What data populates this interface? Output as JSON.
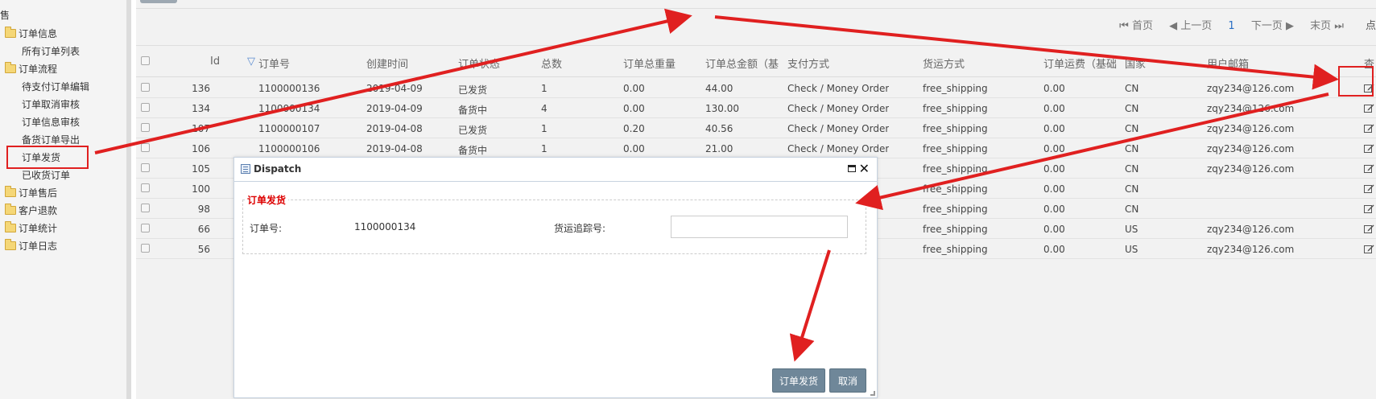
{
  "sidebar": {
    "top_label": "售",
    "items": [
      {
        "type": "folder",
        "label": "订单信息"
      },
      {
        "type": "leaf",
        "label": "所有订单列表"
      },
      {
        "type": "folder",
        "label": "订单流程"
      },
      {
        "type": "leaf",
        "label": "待支付订单编辑"
      },
      {
        "type": "leaf",
        "label": "订单取消审核"
      },
      {
        "type": "leaf",
        "label": "订单信息审核"
      },
      {
        "type": "leaf",
        "label": "备货订单导出"
      },
      {
        "type": "leaf",
        "label": "订单发货"
      },
      {
        "type": "leaf",
        "label": "已收货订单"
      },
      {
        "type": "folder",
        "label": "订单售后"
      },
      {
        "type": "folder",
        "label": "客户退款"
      },
      {
        "type": "folder",
        "label": "订单统计"
      },
      {
        "type": "folder",
        "label": "订单日志"
      }
    ]
  },
  "pager": {
    "first": "首页",
    "prev": "上一页",
    "current": "1",
    "next": "下一页",
    "last": "末页",
    "extra": "点"
  },
  "table": {
    "columns": [
      "Id",
      "订单号",
      "创建时间",
      "订单状态",
      "总数",
      "订单总重量",
      "订单总金额（基",
      "支付方式",
      "货运方式",
      "订单运费（基础",
      "国家",
      "用户邮箱",
      "查"
    ],
    "rows": [
      [
        "136",
        "1100000136",
        "2019-04-09",
        "已发货",
        "1",
        "0.00",
        "44.00",
        "Check / Money Order",
        "free_shipping",
        "0.00",
        "CN",
        "zqy234@126.com"
      ],
      [
        "134",
        "1100000134",
        "2019-04-09",
        "备货中",
        "4",
        "0.00",
        "130.00",
        "Check / Money Order",
        "free_shipping",
        "0.00",
        "CN",
        "zqy234@126.com"
      ],
      [
        "107",
        "1100000107",
        "2019-04-08",
        "已发货",
        "1",
        "0.20",
        "40.56",
        "Check / Money Order",
        "free_shipping",
        "0.00",
        "CN",
        "zqy234@126.com"
      ],
      [
        "106",
        "1100000106",
        "2019-04-08",
        "备货中",
        "1",
        "0.00",
        "21.00",
        "Check / Money Order",
        "free_shipping",
        "0.00",
        "CN",
        "zqy234@126.com"
      ],
      [
        "105",
        "",
        "",
        "",
        "",
        "",
        "",
        "",
        "free_shipping",
        "0.00",
        "CN",
        "zqy234@126.com"
      ],
      [
        "100",
        "",
        "",
        "",
        "",
        "",
        "",
        "",
        "free_shipping",
        "0.00",
        "CN",
        ""
      ],
      [
        "98",
        "",
        "",
        "",
        "",
        "",
        "",
        "",
        "free_shipping",
        "0.00",
        "CN",
        ""
      ],
      [
        "66",
        "",
        "",
        "",
        "",
        "",
        "",
        "",
        "free_shipping",
        "0.00",
        "US",
        "zqy234@126.com"
      ],
      [
        "56",
        "",
        "",
        "",
        "",
        "",
        "",
        "",
        "free_shipping",
        "0.00",
        "US",
        "zqy234@126.com"
      ]
    ]
  },
  "dialog": {
    "title": "Dispatch",
    "section_title": "订单发货",
    "order_no_label": "订单号:",
    "order_no_value": "1100000134",
    "tracking_label": "货运追踪号:",
    "tracking_value": "",
    "confirm_button": "订单发货",
    "cancel_button": "取消"
  },
  "colors": {
    "annotation": "#e02020",
    "accent": "#2a6fc4",
    "button": "#6f8799",
    "legend": "#dd0000"
  }
}
